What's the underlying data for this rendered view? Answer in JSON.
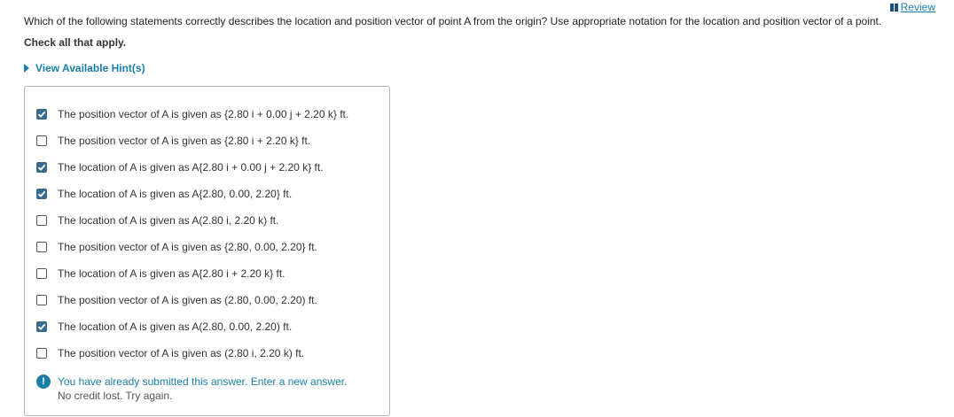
{
  "header": {
    "review_label": "Review"
  },
  "question": {
    "text": "Which of the following statements correctly describes the location and position vector of point A from the origin? Use appropriate notation for the location and position vector of a point.",
    "instruction": "Check all that apply.",
    "hints_label": "View Available Hint(s)"
  },
  "options": [
    {
      "text": "The position vector of A is given as {2.80 i + 0.00 j + 2.20 k} ft.",
      "checked": true
    },
    {
      "text": "The position vector of A is given as {2.80 i + 2.20 k} ft.",
      "checked": false
    },
    {
      "text": "The location of A is given as A{2.80 i + 0.00 j + 2.20 k} ft.",
      "checked": true
    },
    {
      "text": "The location of A is given as A{2.80, 0.00, 2.20} ft.",
      "checked": true
    },
    {
      "text": "The location of A is given as A(2.80 i, 2.20 k) ft.",
      "checked": false
    },
    {
      "text": "The position vector of A is given as {2.80, 0.00, 2.20} ft.",
      "checked": false
    },
    {
      "text": "The location of A is given as A{2.80 i + 2.20 k} ft.",
      "checked": false
    },
    {
      "text": "The position vector of A is given as (2.80, 0.00, 2.20) ft.",
      "checked": false
    },
    {
      "text": "The location of A is given as A(2.80, 0.00, 2.20) ft.",
      "checked": true
    },
    {
      "text": "The position vector of A is given as (2.80 i, 2.20 k) ft.",
      "checked": false
    }
  ],
  "feedback": {
    "icon": "exclamation-icon",
    "main": "You have already submitted this answer. Enter a new answer.",
    "sub": "No credit lost. Try again."
  },
  "colors": {
    "accent": "#1a7fa8",
    "checkbox_checked": "#3b6a8f"
  }
}
